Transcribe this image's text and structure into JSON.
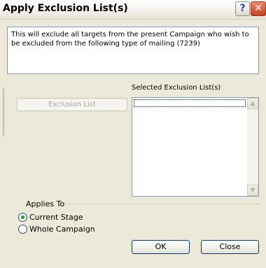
{
  "window": {
    "title": "Apply Exclusion List(s)",
    "help_glyph": "?",
    "close_glyph": "✕"
  },
  "description": "This will exclude all targets from the present Campaign who wish to be excluded from the following type of mailing (7239)",
  "exclusion_button_label": "Exclusion List",
  "selected_list": {
    "label": "Selected Exclusion List(s)",
    "items": []
  },
  "applies_to": {
    "label": "Applies To",
    "options": [
      {
        "label": "Current Stage",
        "selected": true
      },
      {
        "label": "Whole Campaign",
        "selected": false
      }
    ]
  },
  "buttons": {
    "ok": "OK",
    "close": "Close"
  }
}
